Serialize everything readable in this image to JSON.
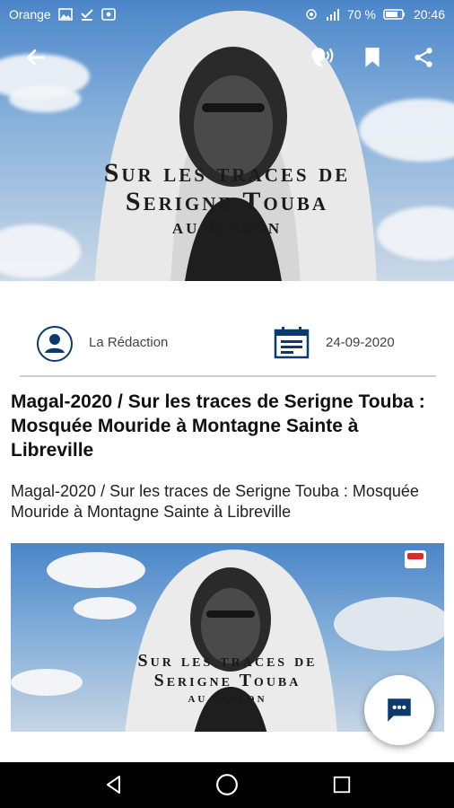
{
  "status_bar": {
    "carrier": "Orange",
    "battery": "70 %",
    "time": "20:46"
  },
  "app_bar": {
    "icons": [
      "back-arrow-icon",
      "text-to-speech-icon",
      "bookmark-icon",
      "share-icon"
    ]
  },
  "hero": {
    "title_line1": "Sur les traces de",
    "title_line2": "Serigne Touba",
    "title_line3": "au Gabon"
  },
  "meta": {
    "author": "La Rédaction",
    "date": "24-09-2020"
  },
  "article": {
    "headline": "Magal-2020 / Sur les traces de Serigne Touba : Mosquée Mouride à Montagne Sainte à Libreville",
    "summary": "Magal-2020 / Sur les traces de Serigne Touba : Mosquée Mouride à Montagne Sainte à Libreville",
    "image_title_line1": "Sur les traces de",
    "image_title_line2": "Serigne Touba",
    "image_title_line3": "au Gabon"
  },
  "fab": {
    "icon": "chat-icon"
  },
  "nav_bar": {
    "icons": [
      "back-triangle-icon",
      "home-circle-icon",
      "recents-square-icon"
    ]
  },
  "colors": {
    "accent": "#0d3a6e",
    "divider": "#c5d0e4",
    "nav_bg": "#000000"
  }
}
